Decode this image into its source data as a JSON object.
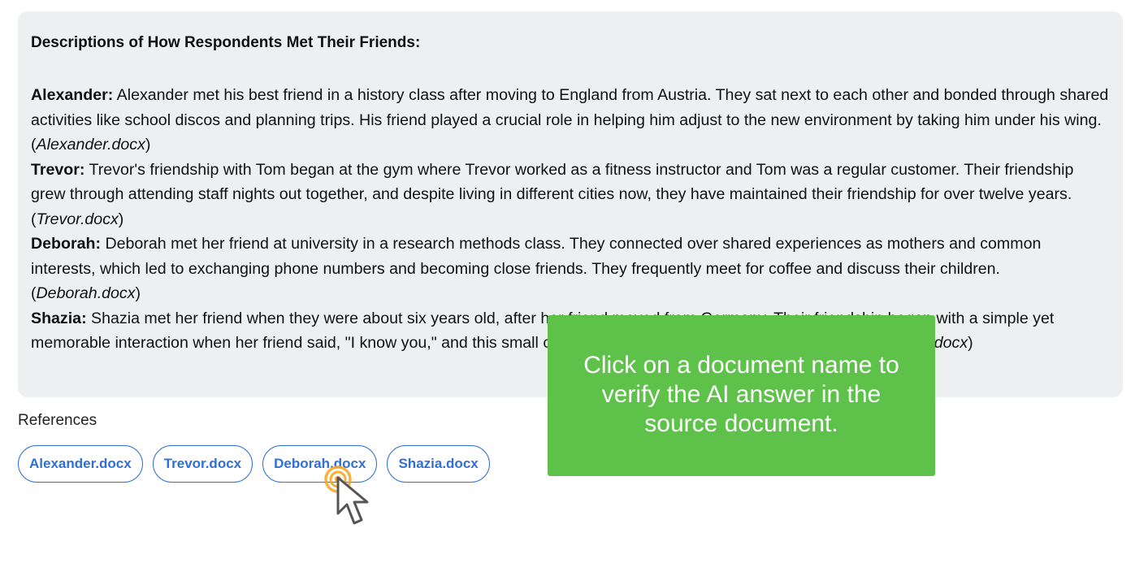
{
  "answer": {
    "title": "Descriptions of How Respondents Met Their Friends:",
    "entries": [
      {
        "name": "Alexander:",
        "text": " Alexander met his best friend in a history class after moving to England from Austria. They sat next to each other and bonded through shared activities like school discos and planning trips. His friend played a crucial role in helping him adjust to the new environment by taking him under his wing. (",
        "doc": "Alexander.docx",
        "close": ")"
      },
      {
        "name": "Trevor:",
        "text": " Trevor's friendship with Tom began at the gym where Trevor worked as a fitness instructor and Tom was a regular customer. Their friendship grew through attending staff nights out together, and despite living in different cities now, they have maintained their friendship for over twelve years. (",
        "doc": "Trevor.docx",
        "close": ")"
      },
      {
        "name": "Deborah:",
        "text": " Deborah met her friend at university in a research methods class. They connected over shared experiences as mothers and common interests, which led to exchanging phone numbers and becoming close friends. They frequently meet for coffee and discuss their children. (",
        "doc": "Deborah.docx",
        "close": ")"
      },
      {
        "name": "Shazia:",
        "text": " Shazia met her friend when they were about six years old, after her friend moved from Germany. Their friendship began with a simple yet memorable interaction when her friend said, \"I know you,\" and this small conversation sparked a long-lasting friendship. (",
        "doc": "Shazia.docx",
        "close": ")"
      }
    ]
  },
  "references": {
    "label": "References",
    "items": [
      {
        "label": "Alexander.docx"
      },
      {
        "label": "Trevor.docx"
      },
      {
        "label": "Deborah.docx"
      },
      {
        "label": "Shazia.docx"
      }
    ]
  },
  "tooltip": {
    "text": "Click on a document name to verify the AI answer in the source document."
  },
  "colors": {
    "answer_bg": "#eeeff1",
    "link": "#2f6fd6",
    "tooltip_bg": "#5ec24a",
    "cursor_highlight": "#f5a623"
  },
  "icons": {
    "cursor": "pointer-cursor-icon",
    "click": "click-ripple-icon"
  }
}
